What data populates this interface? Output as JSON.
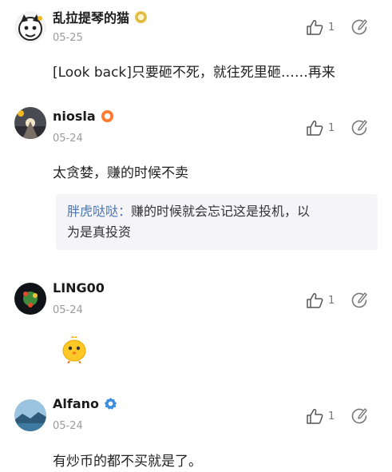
{
  "comments": [
    {
      "username": "乱拉提琴的猫",
      "date": "05-25",
      "likes": "1",
      "text": "[Look back]只要砸不死，就往死里砸……再来",
      "badge": "medal-icon"
    },
    {
      "username": "niosla",
      "date": "05-24",
      "likes": "1",
      "text": "太贪婪，赚的时候不卖",
      "badge": "flame-badge-icon",
      "quote": {
        "name": "胖虎哒哒：",
        "line1": "赚的时候就会忘记这是投机，以",
        "line2": "为是真投资"
      }
    },
    {
      "username": "LING00",
      "date": "05-24",
      "likes": "1",
      "emoji": "chick-emoji-icon"
    },
    {
      "username": "Alfano",
      "date": "05-24",
      "likes": "1",
      "text": "有炒币的都不买就是了。",
      "badge": "verified-badge-icon"
    }
  ],
  "colors": {
    "reply_name": "#4a76b8",
    "date": "#9a9a9a",
    "quote_bg": "#f5f5f7"
  }
}
